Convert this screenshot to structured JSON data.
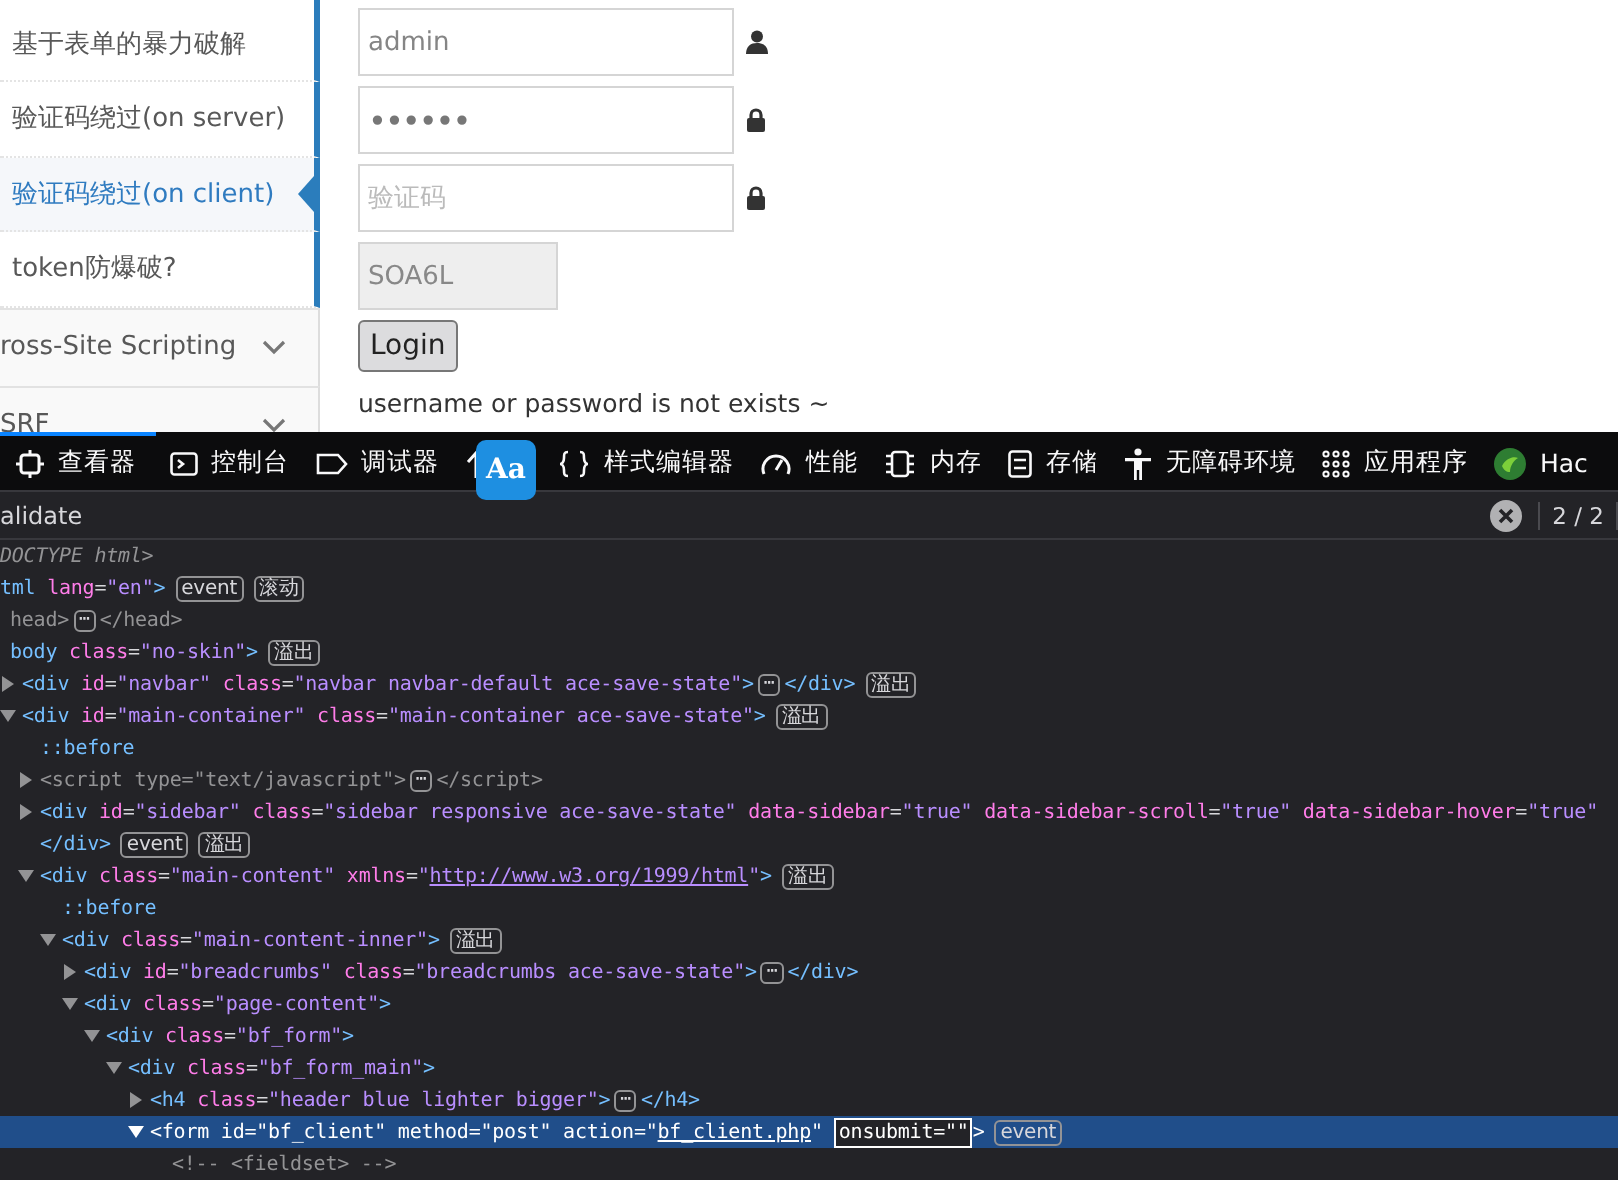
{
  "sidebar": {
    "items": [
      {
        "label": "基于表单的暴力破解",
        "kind": "sub",
        "selected": false
      },
      {
        "label": "验证码绕过(on server)",
        "kind": "sub",
        "selected": false
      },
      {
        "label": "验证码绕过(on client)",
        "kind": "sub",
        "selected": true
      },
      {
        "label": "token防爆破?",
        "kind": "sub",
        "selected": false
      },
      {
        "label": "ross-Site Scripting",
        "kind": "group",
        "selected": false
      },
      {
        "label": "SRF",
        "kind": "group",
        "selected": false
      }
    ]
  },
  "login_form": {
    "username": "admin",
    "password": "••••••",
    "captcha_placeholder": "验证码",
    "captcha_code": "SOA6L",
    "login_button": "Login",
    "message": "username or password is not exists ~"
  },
  "devtools": {
    "tabs": [
      {
        "label": "查看器",
        "kind": "inspector",
        "selected": true
      },
      {
        "label": "控制台",
        "kind": "console",
        "selected": false
      },
      {
        "label": "调试器",
        "kind": "debugger",
        "selected": false
      },
      {
        "kind": "network",
        "selected": false
      },
      {
        "label": "样式编辑器",
        "kind": "style",
        "selected": false
      },
      {
        "label": "性能",
        "kind": "performance",
        "selected": false
      },
      {
        "label": "内存",
        "kind": "memory",
        "selected": false
      },
      {
        "label": "存储",
        "kind": "storage",
        "selected": false
      },
      {
        "label": "无障碍环境",
        "kind": "accessibility",
        "selected": false
      },
      {
        "label": "应用程序",
        "kind": "application",
        "selected": false
      },
      {
        "label": "Hac",
        "kind": "extension",
        "selected": false
      }
    ],
    "overlay_badge": {
      "label": "Aa"
    },
    "search": {
      "value": "alidate",
      "match_count": "2 / 2"
    },
    "tree": [
      {
        "kind": "plain",
        "selected": false,
        "tokens": [
          {
            "kind": "doctype",
            "text": "DOCTYPE html>"
          }
        ]
      },
      {
        "kind": "plain",
        "selected": false,
        "tokens": [
          {
            "kind": "tag",
            "text": "tml"
          },
          {
            "kind": "attr",
            "text": " lang"
          },
          {
            "kind": "p",
            "text": "="
          },
          {
            "kind": "val",
            "text": "\"en\""
          },
          {
            "kind": "tag",
            "text": ">"
          },
          {
            "kind": "badge",
            "text": "event"
          },
          {
            "kind": "badge",
            "text": "滚动"
          }
        ],
        "children": [
          {
            "kind": "plain",
            "selected": false,
            "tokens": [
              {
                "kind": "dim",
                "text": "head>"
              },
              {
                "kind": "more",
                "text": "⋯"
              },
              {
                "kind": "dim",
                "text": "</head>"
              }
            ]
          },
          {
            "kind": "plain",
            "selected": false,
            "tokens": [
              {
                "kind": "tag",
                "text": "body"
              },
              {
                "kind": "attr",
                "text": " class"
              },
              {
                "kind": "p",
                "text": "="
              },
              {
                "kind": "val",
                "text": "\"no-skin\""
              },
              {
                "kind": "tag",
                "text": ">"
              },
              {
                "kind": "badge",
                "text": "溢出"
              }
            ],
            "children": [
              {
                "kind": "branch",
                "expanded": false,
                "selected": false,
                "tokens": [
                  {
                    "kind": "tag",
                    "text": "<div"
                  },
                  {
                    "kind": "attr",
                    "text": " id"
                  },
                  {
                    "kind": "p",
                    "text": "="
                  },
                  {
                    "kind": "val",
                    "text": "\"navbar\""
                  },
                  {
                    "kind": "attr",
                    "text": " class"
                  },
                  {
                    "kind": "p",
                    "text": "="
                  },
                  {
                    "kind": "val",
                    "text": "\"navbar navbar-default ace-save-state\""
                  },
                  {
                    "kind": "tag",
                    "text": ">"
                  },
                  {
                    "kind": "more",
                    "text": "⋯"
                  },
                  {
                    "kind": "tag",
                    "text": "</div>"
                  },
                  {
                    "kind": "badge",
                    "text": "溢出"
                  }
                ]
              },
              {
                "kind": "branch",
                "expanded": true,
                "selected": false,
                "tokens": [
                  {
                    "kind": "tag",
                    "text": "<div"
                  },
                  {
                    "kind": "attr",
                    "text": " id"
                  },
                  {
                    "kind": "p",
                    "text": "="
                  },
                  {
                    "kind": "val",
                    "text": "\"main-container\""
                  },
                  {
                    "kind": "attr",
                    "text": " class"
                  },
                  {
                    "kind": "p",
                    "text": "="
                  },
                  {
                    "kind": "val",
                    "text": "\"main-container ace-save-state\""
                  },
                  {
                    "kind": "tag",
                    "text": ">"
                  },
                  {
                    "kind": "badge",
                    "text": "溢出"
                  }
                ],
                "children": [
                  {
                    "kind": "plain",
                    "selected": false,
                    "tokens": [
                      {
                        "kind": "pseudo",
                        "text": "::before"
                      }
                    ]
                  },
                  {
                    "kind": "branch",
                    "expanded": false,
                    "selected": false,
                    "tokens": [
                      {
                        "kind": "dim",
                        "text": "<script type=\"text/javascript\">"
                      },
                      {
                        "kind": "more",
                        "text": "⋯"
                      },
                      {
                        "kind": "dim",
                        "text": "</script>"
                      }
                    ]
                  },
                  {
                    "kind": "branch",
                    "expanded": false,
                    "selected": false,
                    "tokens": [
                      {
                        "kind": "tag",
                        "text": "<div"
                      },
                      {
                        "kind": "attr",
                        "text": " id"
                      },
                      {
                        "kind": "p",
                        "text": "="
                      },
                      {
                        "kind": "val",
                        "text": "\"sidebar\""
                      },
                      {
                        "kind": "attr",
                        "text": " class"
                      },
                      {
                        "kind": "p",
                        "text": "="
                      },
                      {
                        "kind": "val",
                        "text": "\"sidebar responsive ace-save-state\""
                      },
                      {
                        "kind": "attr",
                        "text": " data-sidebar"
                      },
                      {
                        "kind": "p",
                        "text": "="
                      },
                      {
                        "kind": "val",
                        "text": "\"true\""
                      },
                      {
                        "kind": "attr",
                        "text": " data-sidebar-scroll"
                      },
                      {
                        "kind": "p",
                        "text": "="
                      },
                      {
                        "kind": "val",
                        "text": "\"true\""
                      },
                      {
                        "kind": "attr",
                        "text": " data-sidebar-hover"
                      },
                      {
                        "kind": "p",
                        "text": "="
                      },
                      {
                        "kind": "val",
                        "text": "\"true\""
                      }
                    ]
                  },
                  {
                    "kind": "plain",
                    "selected": false,
                    "tokens": [
                      {
                        "kind": "tag",
                        "text": "</div>"
                      },
                      {
                        "kind": "badge",
                        "text": "event"
                      },
                      {
                        "kind": "badge",
                        "text": "溢出"
                      }
                    ]
                  },
                  {
                    "kind": "branch",
                    "expanded": true,
                    "selected": false,
                    "tokens": [
                      {
                        "kind": "tag",
                        "text": "<div"
                      },
                      {
                        "kind": "attr",
                        "text": " class"
                      },
                      {
                        "kind": "p",
                        "text": "="
                      },
                      {
                        "kind": "val",
                        "text": "\"main-content\""
                      },
                      {
                        "kind": "attr",
                        "text": " xmlns"
                      },
                      {
                        "kind": "p",
                        "text": "="
                      },
                      {
                        "kind": "val",
                        "text": "\""
                      },
                      {
                        "kind": "link",
                        "text": "http://www.w3.org/1999/html"
                      },
                      {
                        "kind": "val",
                        "text": "\""
                      },
                      {
                        "kind": "tag",
                        "text": ">"
                      },
                      {
                        "kind": "badge",
                        "text": "溢出"
                      }
                    ],
                    "children": [
                      {
                        "kind": "plain",
                        "selected": false,
                        "tokens": [
                          {
                            "kind": "pseudo",
                            "text": "::before"
                          }
                        ]
                      },
                      {
                        "kind": "branch",
                        "expanded": true,
                        "selected": false,
                        "tokens": [
                          {
                            "kind": "tag",
                            "text": "<div"
                          },
                          {
                            "kind": "attr",
                            "text": " class"
                          },
                          {
                            "kind": "p",
                            "text": "="
                          },
                          {
                            "kind": "val",
                            "text": "\"main-content-inner\""
                          },
                          {
                            "kind": "tag",
                            "text": ">"
                          },
                          {
                            "kind": "badge",
                            "text": "溢出"
                          }
                        ],
                        "children": [
                          {
                            "kind": "branch",
                            "expanded": false,
                            "selected": false,
                            "tokens": [
                              {
                                "kind": "tag",
                                "text": "<div"
                              },
                              {
                                "kind": "attr",
                                "text": " id"
                              },
                              {
                                "kind": "p",
                                "text": "="
                              },
                              {
                                "kind": "val",
                                "text": "\"breadcrumbs\""
                              },
                              {
                                "kind": "attr",
                                "text": " class"
                              },
                              {
                                "kind": "p",
                                "text": "="
                              },
                              {
                                "kind": "val",
                                "text": "\"breadcrumbs ace-save-state\""
                              },
                              {
                                "kind": "tag",
                                "text": ">"
                              },
                              {
                                "kind": "more",
                                "text": "⋯"
                              },
                              {
                                "kind": "tag",
                                "text": "</div>"
                              }
                            ]
                          },
                          {
                            "kind": "branch",
                            "expanded": true,
                            "selected": false,
                            "tokens": [
                              {
                                "kind": "tag",
                                "text": "<div"
                              },
                              {
                                "kind": "attr",
                                "text": " class"
                              },
                              {
                                "kind": "p",
                                "text": "="
                              },
                              {
                                "kind": "val",
                                "text": "\"page-content\""
                              },
                              {
                                "kind": "tag",
                                "text": ">"
                              }
                            ],
                            "children": [
                              {
                                "kind": "branch",
                                "expanded": true,
                                "selected": false,
                                "tokens": [
                                  {
                                    "kind": "tag",
                                    "text": "<div"
                                  },
                                  {
                                    "kind": "attr",
                                    "text": " class"
                                  },
                                  {
                                    "kind": "p",
                                    "text": "="
                                  },
                                  {
                                    "kind": "val",
                                    "text": "\"bf_form\""
                                  },
                                  {
                                    "kind": "tag",
                                    "text": ">"
                                  }
                                ],
                                "children": [
                                  {
                                    "kind": "branch",
                                    "expanded": true,
                                    "selected": false,
                                    "tokens": [
                                      {
                                        "kind": "tag",
                                        "text": "<div"
                                      },
                                      {
                                        "kind": "attr",
                                        "text": " class"
                                      },
                                      {
                                        "kind": "p",
                                        "text": "="
                                      },
                                      {
                                        "kind": "val",
                                        "text": "\"bf_form_main\""
                                      },
                                      {
                                        "kind": "tag",
                                        "text": ">"
                                      }
                                    ],
                                    "children": [
                                      {
                                        "kind": "branch",
                                        "expanded": false,
                                        "selected": false,
                                        "tokens": [
                                          {
                                            "kind": "tag",
                                            "text": "<h4"
                                          },
                                          {
                                            "kind": "attr",
                                            "text": " class"
                                          },
                                          {
                                            "kind": "p",
                                            "text": "="
                                          },
                                          {
                                            "kind": "val",
                                            "text": "\"header blue lighter bigger\""
                                          },
                                          {
                                            "kind": "tag",
                                            "text": ">"
                                          },
                                          {
                                            "kind": "more",
                                            "text": "⋯"
                                          },
                                          {
                                            "kind": "tag",
                                            "text": "</h4>"
                                          }
                                        ]
                                      },
                                      {
                                        "kind": "branch",
                                        "expanded": true,
                                        "selected": true,
                                        "tokens": [
                                          {
                                            "kind": "tag",
                                            "text": "<form"
                                          },
                                          {
                                            "kind": "attr",
                                            "text": " id"
                                          },
                                          {
                                            "kind": "p",
                                            "text": "="
                                          },
                                          {
                                            "kind": "val",
                                            "text": "\"bf_client\""
                                          },
                                          {
                                            "kind": "attr",
                                            "text": " method"
                                          },
                                          {
                                            "kind": "p",
                                            "text": "="
                                          },
                                          {
                                            "kind": "val",
                                            "text": "\"post\""
                                          },
                                          {
                                            "kind": "attr",
                                            "text": " action"
                                          },
                                          {
                                            "kind": "p",
                                            "text": "="
                                          },
                                          {
                                            "kind": "val",
                                            "text": "\""
                                          },
                                          {
                                            "kind": "link",
                                            "text": "bf_client.php"
                                          },
                                          {
                                            "kind": "val",
                                            "text": "\""
                                          },
                                          {
                                            "kind": "edit",
                                            "text": "onsubmit=\"\""
                                          },
                                          {
                                            "kind": "tag",
                                            "text": ">"
                                          },
                                          {
                                            "kind": "badge",
                                            "text": "event"
                                          }
                                        ],
                                        "children": [
                                          {
                                            "kind": "plain",
                                            "selected": false,
                                            "tokens": [
                                              {
                                                "kind": "comment",
                                                "text": "<!-- <fieldset> -->"
                                              }
                                            ]
                                          }
                                        ]
                                      }
                                    ]
                                  }
                                ]
                              }
                            ]
                          }
                        ]
                      }
                    ]
                  }
                ]
              }
            ]
          }
        ]
      }
    ]
  }
}
